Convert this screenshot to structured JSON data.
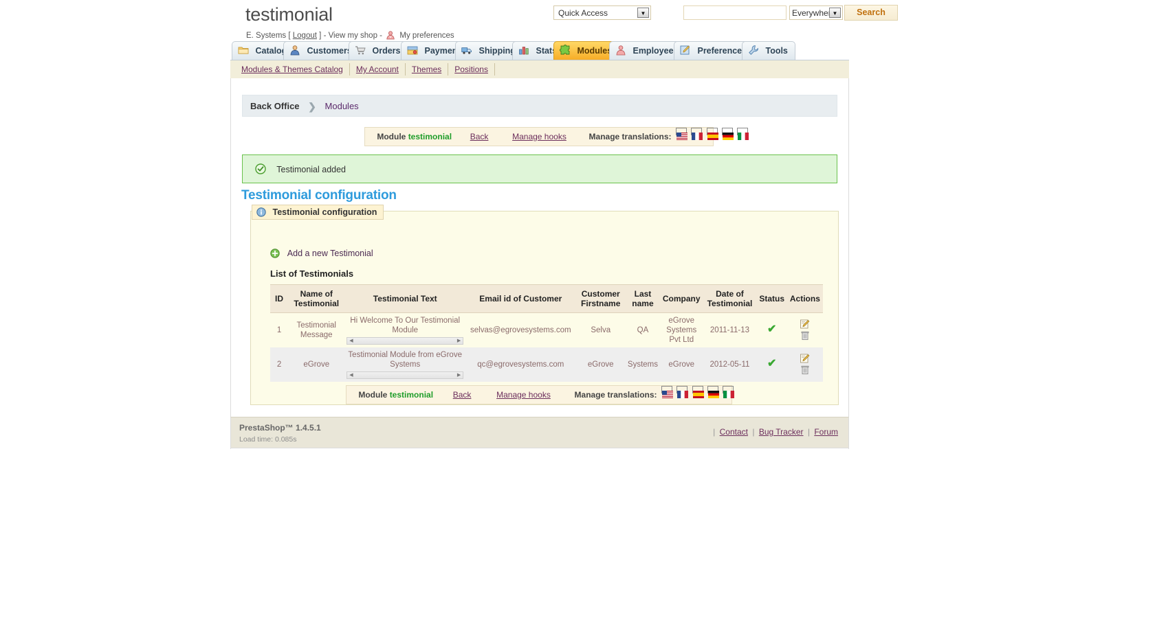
{
  "header": {
    "shop_name": "testimonial",
    "employee_name": "E. Systems",
    "bracket_open": "[",
    "logout_label": "Logout",
    "bracket_close": "]",
    "view_shop_label": "- View my shop -",
    "my_preferences_label": "My preferences",
    "preferences_icon": "user-icon"
  },
  "quick_access": {
    "selected": "Quick Access",
    "dropdown_icon": "chevron-down-icon"
  },
  "search": {
    "value": "",
    "placeholder": "",
    "scope_selected": "Everywhere",
    "scope_dropdown_icon": "chevron-down-icon",
    "button_label": "Search",
    "accent": "#c0700d"
  },
  "tabs": [
    {
      "label": "Catalog",
      "icon": "folder-icon",
      "active": false
    },
    {
      "label": "Customers",
      "icon": "customer-icon",
      "active": false
    },
    {
      "label": "Orders",
      "icon": "cart-icon",
      "active": false
    },
    {
      "label": "Payment",
      "icon": "payment-icon",
      "active": false
    },
    {
      "label": "Shipping",
      "icon": "truck-icon",
      "active": false
    },
    {
      "label": "Stats",
      "icon": "chart-icon",
      "active": false
    },
    {
      "label": "Modules",
      "icon": "puzzle-icon",
      "active": true
    },
    {
      "label": "Employees",
      "icon": "employee-icon",
      "active": false
    },
    {
      "label": "Preferences",
      "icon": "pencil-pad-icon",
      "active": false
    },
    {
      "label": "Tools",
      "icon": "wrench-icon",
      "active": false
    }
  ],
  "subtabs": [
    {
      "label": "Modules & Themes Catalog"
    },
    {
      "label": "My Account"
    },
    {
      "label": "Themes"
    },
    {
      "label": "Positions"
    }
  ],
  "breadcrumb": {
    "root": "Back Office",
    "separator_icon": "chevron-right-icon",
    "current": "Modules"
  },
  "module_toolbar": {
    "module_prefix": "Module",
    "module_name": "testimonial",
    "back_label": "Back",
    "manage_hooks_label": "Manage hooks",
    "translations_label": "Manage translations:",
    "flags": [
      "flag-en",
      "flag-fr",
      "flag-es",
      "flag-de",
      "flag-it"
    ]
  },
  "confirmation": {
    "icon": "success-check-icon",
    "message": "Testimonial added",
    "color": "#69c14b"
  },
  "page_heading": "Testimonial configuration",
  "panel": {
    "legend_icon": "info-icon",
    "legend": "Testimonial configuration",
    "add_new_icon": "add-circle-icon",
    "add_new_label": "Add a new Testimonial",
    "list_title": "List of Testimonials"
  },
  "table": {
    "columns": [
      "ID",
      "Name of Testimonial",
      "Testimonial Text",
      "Email id of Customer",
      "Customer Firstname",
      "Last name",
      "Company",
      "Date of Testimonial",
      "Status",
      "Actions"
    ],
    "rows": [
      {
        "id": "1",
        "name": "Testimonial Message",
        "text": "Hi Welcome To Our Testimonial Module",
        "email": "selvas@egrovesystems.com",
        "firstname": "Selva",
        "lastname": "QA",
        "company": "eGrove Systems Pvt Ltd",
        "date": "2011-11-13",
        "status_icon": "green-check-icon",
        "edit_icon": "edit-icon",
        "delete_icon": "trash-icon"
      },
      {
        "id": "2",
        "name": "eGrove",
        "text": "Testimonial Module from eGrove Systems",
        "email": "qc@egrovesystems.com",
        "firstname": "eGrove",
        "lastname": "Systems",
        "company": "eGrove",
        "date": "2012-05-11",
        "status_icon": "green-check-icon",
        "edit_icon": "edit-icon",
        "delete_icon": "trash-icon"
      }
    ],
    "scroll_left_icon": "arrow-left-icon",
    "scroll_right_icon": "arrow-right-icon"
  },
  "footer": {
    "version": "PrestaShop™ 1.4.5.1",
    "load_time": "Load time: 0.085s",
    "links": [
      "Contact",
      "Bug Tracker",
      "Forum"
    ]
  }
}
